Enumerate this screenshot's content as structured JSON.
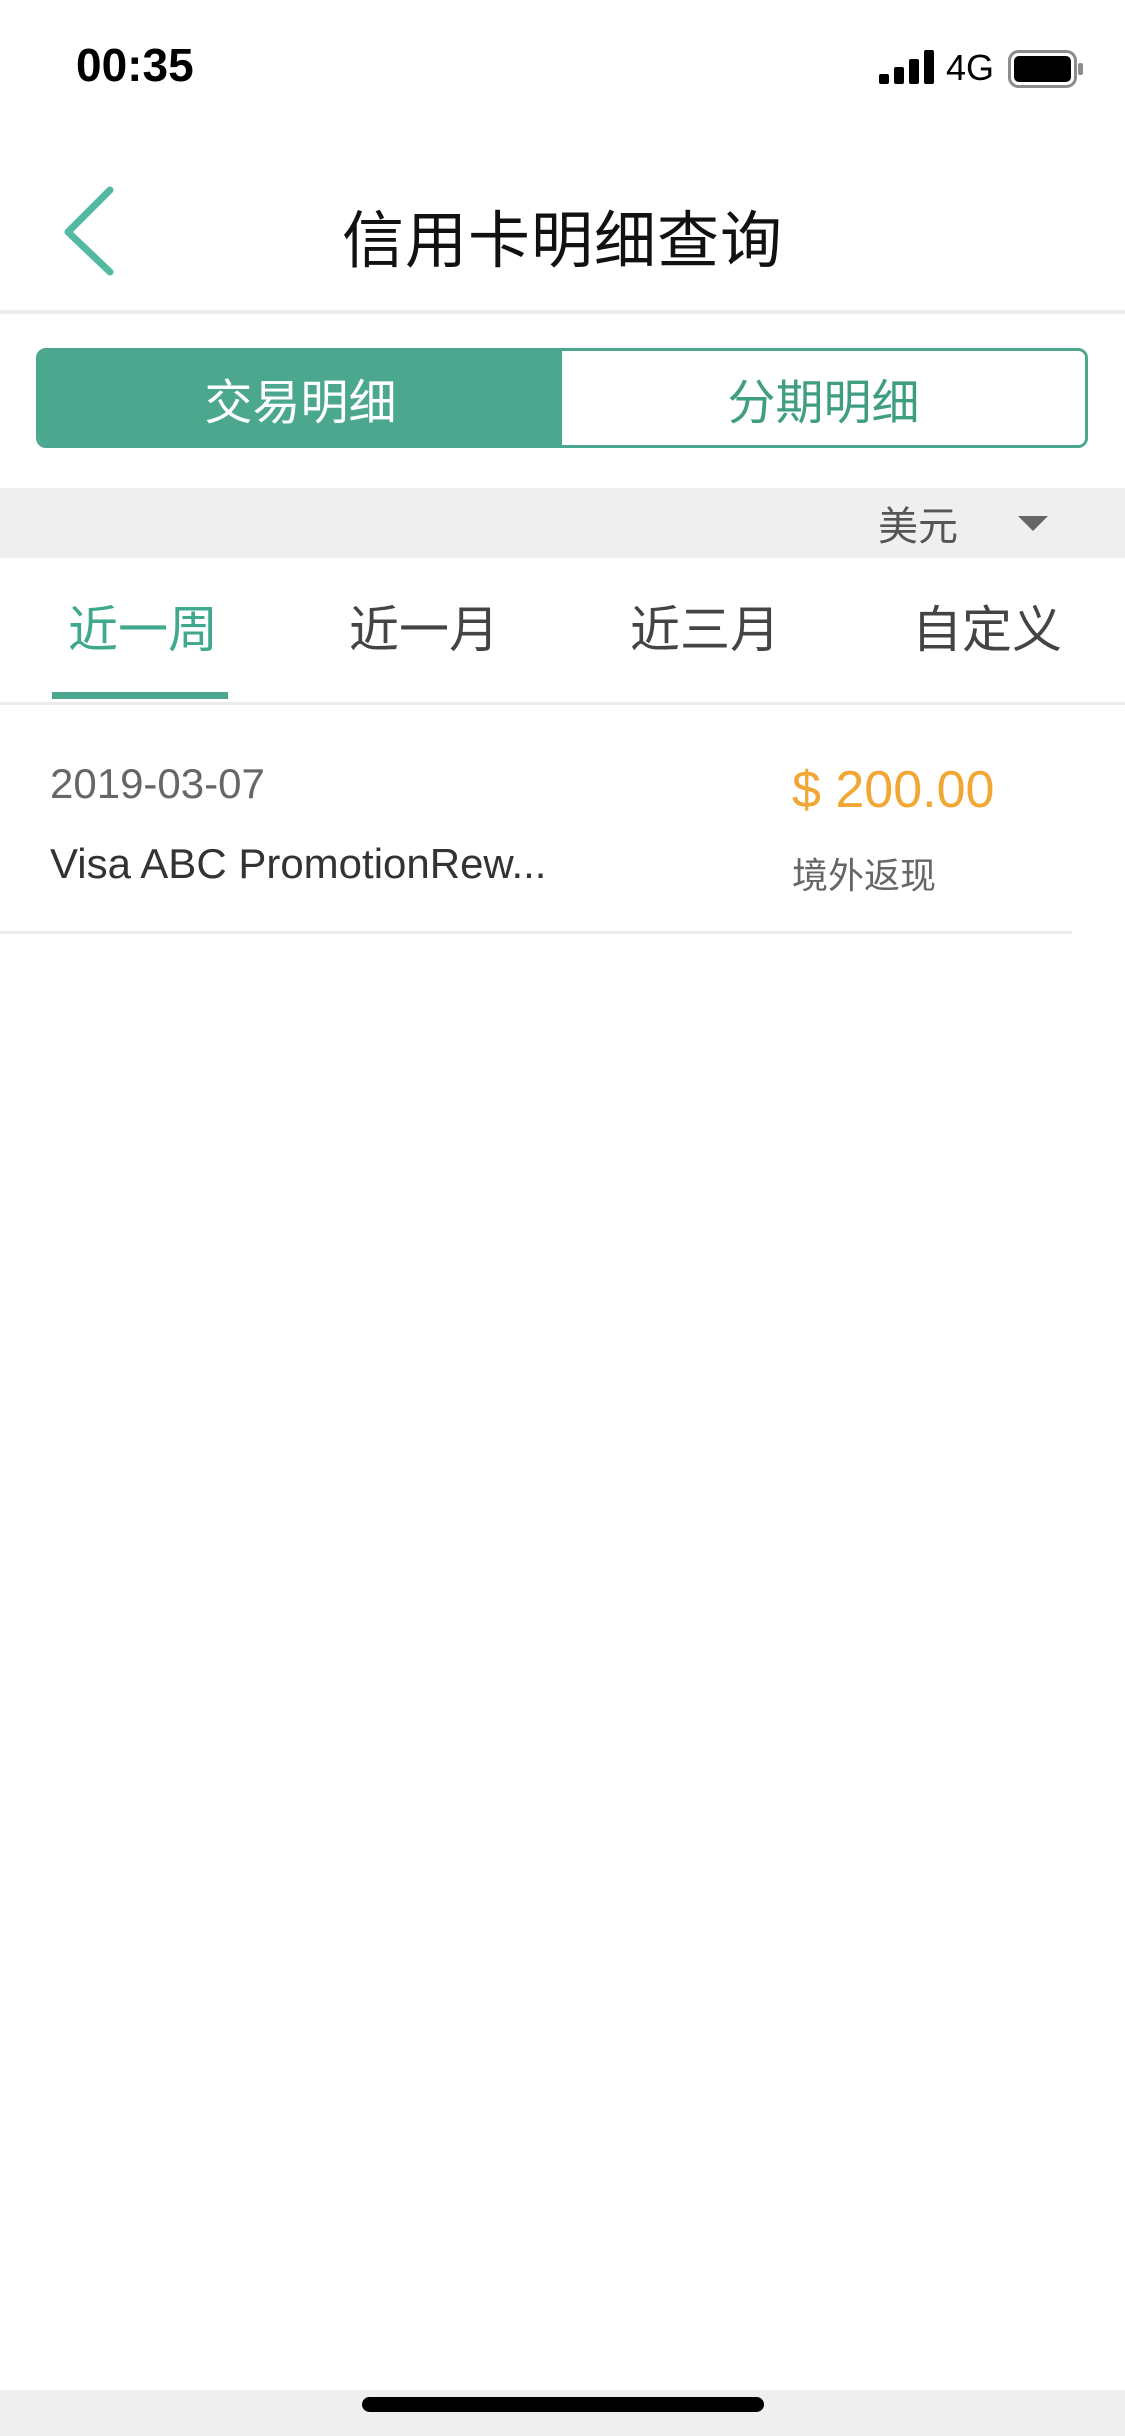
{
  "status_bar": {
    "time": "00:35",
    "network": "4G",
    "icons": [
      "signal-icon",
      "battery-icon"
    ]
  },
  "nav": {
    "title": "信用卡明细查询",
    "back_icon": "chevron-left-icon"
  },
  "segment": {
    "tabs": [
      {
        "label": "交易明细",
        "selected": true
      },
      {
        "label": "分期明细",
        "selected": false
      }
    ]
  },
  "currency": {
    "selected": "美元",
    "icon": "caret-down-icon"
  },
  "period_tabs": {
    "items": [
      {
        "label": "近一周",
        "selected": true
      },
      {
        "label": "近一月",
        "selected": false
      },
      {
        "label": "近三月",
        "selected": false
      },
      {
        "label": "自定义",
        "selected": false
      }
    ]
  },
  "transactions": [
    {
      "date": "2019-03-07",
      "description": "Visa ABC PromotionRew...",
      "amount": "$ 200.00",
      "type": "境外返现"
    }
  ],
  "colors": {
    "accent": "#4ba88f",
    "amount": "#f0a733",
    "divider": "#ececec"
  }
}
